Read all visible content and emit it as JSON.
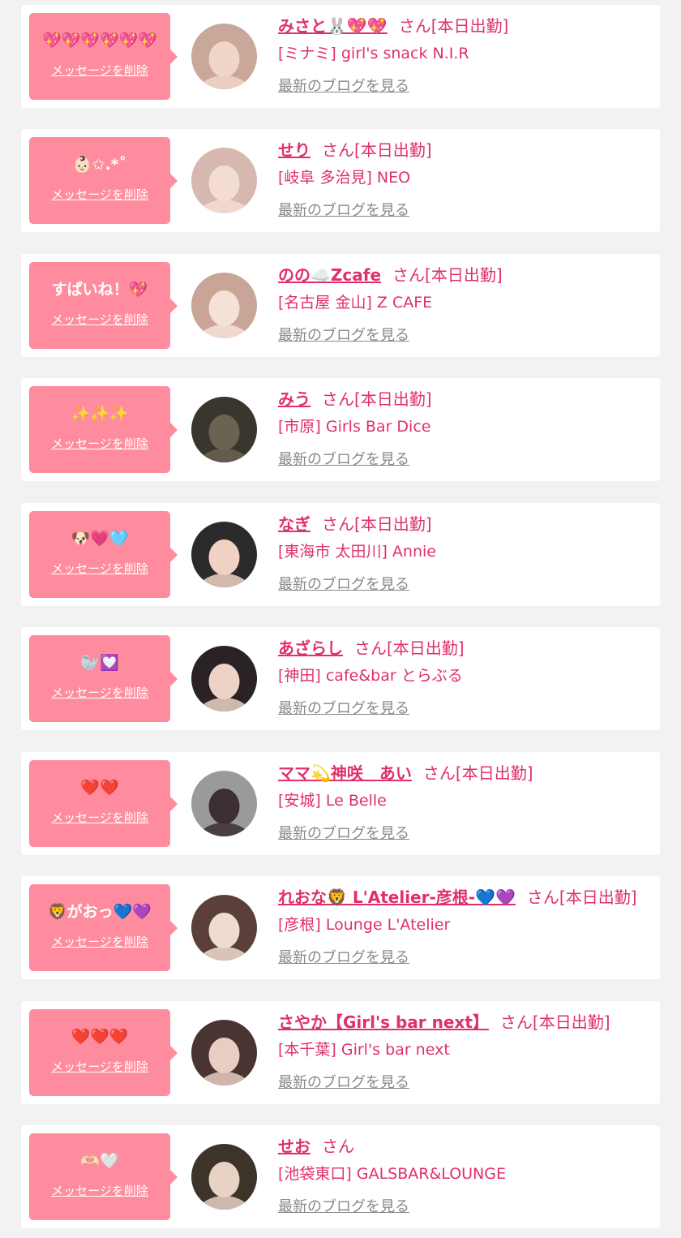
{
  "messages": [
    {
      "message": "💖💖💖💖💖💖",
      "delete_label": "メッセージを削除",
      "name": "みさと🐰💖💖",
      "honorific": "さん",
      "status": "[本日出勤]",
      "shop": "[ミナミ] girl's snack N.I.R",
      "blog_link": "最新のブログを見る",
      "avatar_bg": "#c9a89a",
      "avatar_fg": "#f0d6c8"
    },
    {
      "message": "👶🏻✩.*˚",
      "delete_label": "メッセージを削除",
      "name": "せり",
      "honorific": "さん",
      "status": "[本日出勤]",
      "shop": "[岐阜 多治見] NEO",
      "blog_link": "最新のブログを見る",
      "avatar_bg": "#d7b8b0",
      "avatar_fg": "#f3ddd2"
    },
    {
      "message": "すぱいね！💖",
      "delete_label": "メッセージを削除",
      "name": "のの☁️Zcafe",
      "honorific": "さん",
      "status": "[本日出勤]",
      "shop": "[名古屋 金山] Z CAFE",
      "blog_link": "最新のブログを見る",
      "avatar_bg": "#c8a596",
      "avatar_fg": "#f6e1d8"
    },
    {
      "message": "✨✨✨",
      "delete_label": "メッセージを削除",
      "name": "みう",
      "honorific": "さん",
      "status": "[本日出勤]",
      "shop": "[市原] Girls Bar Dice",
      "blog_link": "最新のブログを見る",
      "avatar_bg": "#3a362e",
      "avatar_fg": "#6b6352"
    },
    {
      "message": "🐶💗🩵",
      "delete_label": "メッセージを削除",
      "name": "なぎ",
      "honorific": "さん",
      "status": "[本日出勤]",
      "shop": "[東海市 太田川] Annie",
      "blog_link": "最新のブログを見る",
      "avatar_bg": "#2d2a2c",
      "avatar_fg": "#efd2c4"
    },
    {
      "message": "🦭💟",
      "delete_label": "メッセージを削除",
      "name": "あざらし",
      "honorific": "さん",
      "status": "[本日出勤]",
      "shop": "[神田] cafe&bar とらぶる",
      "blog_link": "最新のブログを見る",
      "avatar_bg": "#2a2224",
      "avatar_fg": "#ecd3c6"
    },
    {
      "message": "❤️❤️",
      "delete_label": "メッセージを削除",
      "name": "ママ💫神咲　あい",
      "honorific": "さん",
      "status": "[本日出勤]",
      "shop": "[安城] Le Belle",
      "blog_link": "最新のブログを見る",
      "avatar_bg": "#9a9a9a",
      "avatar_fg": "#3b2f33"
    },
    {
      "message": "🦁がおっ💙💜",
      "delete_label": "メッセージを削除",
      "name": "れおな🦁 L'Atelier-彦根-💙💜",
      "honorific": "さん",
      "status": "[本日出勤]",
      "shop": "[彦根] Lounge L'Atelier",
      "blog_link": "最新のブログを見る",
      "avatar_bg": "#5a4038",
      "avatar_fg": "#eedcd0"
    },
    {
      "message": "❤️❤️❤️",
      "delete_label": "メッセージを削除",
      "name": "さやか【Girl's bar next】",
      "honorific": "さん",
      "status": "[本日出勤]",
      "shop": "[本千葉] Girl's bar next",
      "blog_link": "最新のブログを見る",
      "avatar_bg": "#4a3432",
      "avatar_fg": "#e8cdc0"
    },
    {
      "message": "🫶🏻🤍",
      "delete_label": "メッセージを削除",
      "name": "せお",
      "honorific": "さん",
      "status": "",
      "shop": "[池袋東口] GALSBAR&LOUNGE",
      "blog_link": "最新のブログを見る",
      "avatar_bg": "#3c3329",
      "avatar_fg": "#e7d2c4"
    }
  ]
}
